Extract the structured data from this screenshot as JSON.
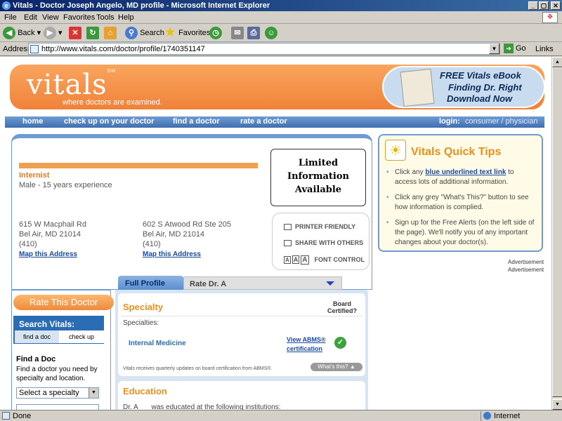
{
  "window": {
    "title": "Vitals - Doctor Joseph Angelo, MD profile - Microsoft Internet Explorer",
    "min": "_",
    "max": "▢",
    "close": "✕"
  },
  "menu": [
    "File",
    "Edit",
    "View",
    "Favorites",
    "Tools",
    "Help"
  ],
  "toolbar": {
    "back": "Back",
    "search": "Search",
    "favorites": "Favorites"
  },
  "address": {
    "label": "Address",
    "url": "http://www.vitals.com/doctor/profile/1740351147",
    "go": "Go",
    "links": "Links"
  },
  "status": {
    "text": "Done",
    "zone": "Internet"
  },
  "site": {
    "logo": "vitals",
    "logo_mark": "SM",
    "tagline": "where doctors are examined.",
    "ebook": [
      "FREE Vitals eBook",
      "Finding Dr. Right",
      "Download Now"
    ],
    "nav": [
      "home",
      "check up on your doctor",
      "find a doctor",
      "rate a doctor"
    ],
    "login_label": "login:",
    "login_links": "consumer / physician"
  },
  "profile": {
    "specialty": "Internist",
    "meta": "Male - 15 years experience",
    "limited": [
      "Limited",
      "Information",
      "Available"
    ],
    "addresses": [
      {
        "street": "615 W Macphail Rd",
        "city": "Bel Air, MD 21014",
        "phone": "(410)",
        "map": "Map this Address"
      },
      {
        "street": "602 S Atwood Rd Ste 205",
        "city": "Bel Air, MD 21014",
        "phone": "(410)",
        "map": "Map this Address"
      }
    ],
    "tools": {
      "printer": "PRINTER FRIENDLY",
      "share": "SHARE WITH OTHERS",
      "font": "FONT CONTROL",
      "font_glyphs": [
        "A",
        "A",
        "A"
      ]
    }
  },
  "quick_tips": {
    "title": "Vitals Quick Tips",
    "items": [
      {
        "pre": "Click any ",
        "link": "blue underlined text link",
        "post": " to access lots of additional information."
      },
      {
        "pre": "Click any grey \"What's This?\" button to see how information is complied.",
        "link": "",
        "post": ""
      },
      {
        "pre": "Sign up for the Free Alerts (on the left side of the page). We'll notify you of any important changes about your doctor(s).",
        "link": "",
        "post": ""
      }
    ],
    "advertisement": "Advertisement"
  },
  "tabs": {
    "full": "Full Profile",
    "rate": "Rate Dr. A"
  },
  "sidebar": {
    "rate_button": "Rate This Doctor",
    "search_title": "Search Vitals:",
    "tab_find": "find a doc",
    "tab_check": "check up",
    "find_title": "Find a Doc",
    "find_desc": "Find a doctor you need by specialty and location.",
    "select_specialty": "Select a specialty"
  },
  "specialty_panel": {
    "title": "Specialty",
    "board": "Board Certified?",
    "label": "Specialties:",
    "value": "Internal Medicine",
    "abms_link": "View ABMS® certification",
    "note": "Vitals receives quarterly updates on board certification from ABMS®.",
    "whats_this": "What's this?"
  },
  "education_panel": {
    "title": "Education",
    "text_pre": "Dr. A",
    "text_post": " was educated at the following institutions:"
  }
}
